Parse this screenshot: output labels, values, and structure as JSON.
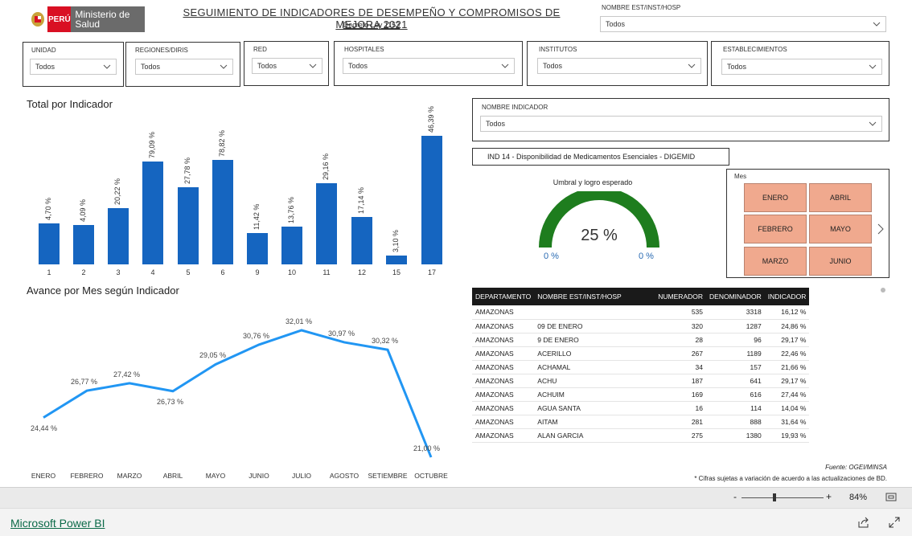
{
  "header": {
    "logo_text": "PERÚ",
    "logo_org": "Ministerio de Salud",
    "title": "SEGUIMIENTO DE INDICADORES DE DESEMPEÑO Y COMPROMISOS DE MEJORA 2021",
    "subtitle": "Decreto Ley 1153"
  },
  "slicers": {
    "nombre_est_top": {
      "label": "NOMBRE EST/INST/HOSP",
      "value": "Todos"
    },
    "unidad": {
      "label": "UNIDAD",
      "value": "Todos"
    },
    "regiones": {
      "label": "REGIONES/DIRIS",
      "value": "Todos"
    },
    "red": {
      "label": "RED",
      "value": "Todos"
    },
    "hospitales": {
      "label": "HOSPITALES",
      "value": "Todos"
    },
    "institutos": {
      "label": "INSTITUTOS",
      "value": "Todos"
    },
    "establecimientos": {
      "label": "ESTABLECIMIENTOS",
      "value": "Todos"
    },
    "nombre_indicador": {
      "label": "NOMBRE INDICADOR",
      "value": "Todos"
    }
  },
  "indicator_banner": "IND 14 - Disponibilidad de Medicamentos Esenciales - DIGEMID",
  "gauge": {
    "title": "Umbral y logro esperado",
    "value_label": "25 %",
    "min_label": "0 %",
    "max_label": "0 %",
    "fill_fraction": 1.0,
    "color": "#1e7d1e"
  },
  "month_slicer": {
    "label": "Mes",
    "months": [
      "ENERO",
      "ABRIL",
      "FEBRERO",
      "MAYO",
      "MARZO",
      "JUNIO"
    ],
    "tile_color": "#f0a98e"
  },
  "charts": {
    "bar_title": "Total por Indicador",
    "line_title": "Avance por Mes según Indicador"
  },
  "chart_data": [
    {
      "type": "bar",
      "title": "Total por Indicador",
      "categories": [
        "1",
        "2",
        "3",
        "4",
        "5",
        "6",
        "9",
        "10",
        "11",
        "12",
        "15",
        "17"
      ],
      "values": [
        14.7,
        14.09,
        20.22,
        37.09,
        27.78,
        37.82,
        11.42,
        13.76,
        29.16,
        17.14,
        3.1,
        46.39
      ],
      "labels": [
        "4,70 %",
        "4,09 %",
        "20,22 %",
        "79,09 %",
        "27,78 %",
        "78,82 %",
        "11,42 %",
        "13,76 %",
        "29,16 %",
        "17,14 %",
        "3,10 %",
        "46,39 %"
      ],
      "color": "#1565c0"
    },
    {
      "type": "line",
      "title": "Avance por Mes según Indicador",
      "x": [
        "ENERO",
        "FEBRERO",
        "MARZO",
        "ABRIL",
        "MAYO",
        "JUNIO",
        "JULIO",
        "AGOSTO",
        "SETIEMBRE",
        "OCTUBRE"
      ],
      "values": [
        24.44,
        26.77,
        27.42,
        26.73,
        29.05,
        30.76,
        32.01,
        30.97,
        30.32,
        21.0
      ],
      "labels": [
        "24,44 %",
        "26,77 %",
        "27,42 %",
        "26,73 %",
        "29,05 %",
        "30,76 %",
        "32,01 %",
        "30,97 %",
        "30,32 %",
        "21,00 %"
      ],
      "color": "#2196f3"
    }
  ],
  "table": {
    "headers": [
      "DEPARTAMENTO",
      "NOMBRE EST/INST/HOSP",
      "NUMERADOR",
      "DENOMINADOR",
      "INDICADOR"
    ],
    "rows": [
      [
        "AMAZONAS",
        "",
        "535",
        "3318",
        "16,12 %"
      ],
      [
        "AMAZONAS",
        "09 DE ENERO",
        "320",
        "1287",
        "24,86 %"
      ],
      [
        "AMAZONAS",
        "9 DE ENERO",
        "28",
        "96",
        "29,17 %"
      ],
      [
        "AMAZONAS",
        "ACERILLO",
        "267",
        "1189",
        "22,46 %"
      ],
      [
        "AMAZONAS",
        "ACHAMAL",
        "34",
        "157",
        "21,66 %"
      ],
      [
        "AMAZONAS",
        "ACHU",
        "187",
        "641",
        "29,17 %"
      ],
      [
        "AMAZONAS",
        "ACHUIM",
        "169",
        "616",
        "27,44 %"
      ],
      [
        "AMAZONAS",
        "AGUA SANTA",
        "16",
        "114",
        "14,04 %"
      ],
      [
        "AMAZONAS",
        "AITAM",
        "281",
        "888",
        "31,64 %"
      ],
      [
        "AMAZONAS",
        "ALAN GARCIA",
        "275",
        "1380",
        "19,93 %"
      ]
    ]
  },
  "notes": {
    "source": "Fuente: OGEI/MINSA",
    "disclaimer": "* Cifras sujetas a variación de acuerdo a las actualizaciones de BD."
  },
  "zoom": {
    "minus": "-",
    "plus": "+",
    "value": "84%"
  },
  "footer": {
    "brand": "Microsoft Power BI"
  }
}
